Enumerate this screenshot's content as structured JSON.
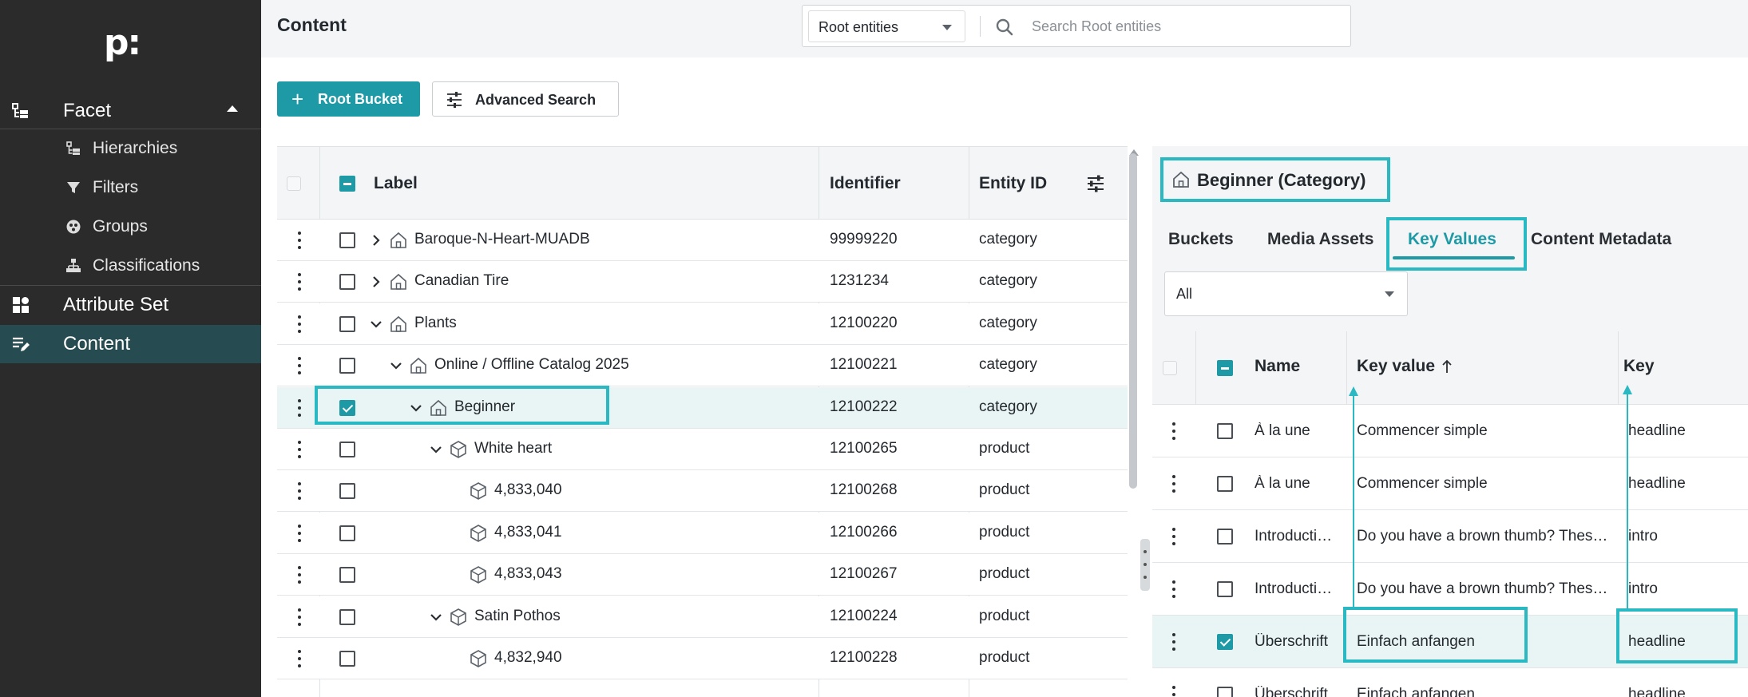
{
  "app": {
    "logo": "p:"
  },
  "sidebar": {
    "facet": {
      "label": "Facet",
      "icon": "facet-icon"
    },
    "sub_items": [
      {
        "label": "Hierarchies",
        "icon": "hierarchy-icon"
      },
      {
        "label": "Filters",
        "icon": "filter-icon"
      },
      {
        "label": "Groups",
        "icon": "groups-icon"
      },
      {
        "label": "Classifications",
        "icon": "classification-icon"
      }
    ],
    "attribute_set": {
      "label": "Attribute Set",
      "icon": "dashboard-icon"
    },
    "content": {
      "label": "Content",
      "icon": "edit-list-icon"
    }
  },
  "header": {
    "title": "Content",
    "scope_select": "Root entities",
    "search_placeholder": "Search Root entities"
  },
  "toolbar": {
    "root_bucket_label": "Root Bucket",
    "advanced_search_label": "Advanced Search"
  },
  "left_table": {
    "headers": {
      "label": "Label",
      "identifier": "Identifier",
      "entity_id": "Entity ID"
    },
    "rows": [
      {
        "label": "Baroque-N-Heart-MUADB",
        "identifier": "99999220",
        "entity_id": "category",
        "checked": false,
        "icon": "category-icon",
        "expander": "collapsed"
      },
      {
        "label": "Canadian Tire",
        "identifier": "1231234",
        "entity_id": "category",
        "checked": false,
        "icon": "category-icon",
        "expander": "collapsed"
      },
      {
        "label": "Plants",
        "identifier": "12100220",
        "entity_id": "category",
        "checked": false,
        "icon": "category-icon",
        "expander": "expanded"
      },
      {
        "label": "Online / Offline Catalog 2025",
        "identifier": "12100221",
        "entity_id": "category",
        "checked": false,
        "icon": "category-icon",
        "expander": "expanded"
      },
      {
        "label": "Beginner",
        "identifier": "12100222",
        "entity_id": "category",
        "checked": true,
        "icon": "category-icon",
        "expander": "expanded"
      },
      {
        "label": "White heart",
        "identifier": "12100265",
        "entity_id": "product",
        "checked": false,
        "icon": "product-icon",
        "expander": "expanded"
      },
      {
        "label": "4,833,040",
        "identifier": "12100268",
        "entity_id": "product",
        "checked": false,
        "icon": "product-icon",
        "expander": "none"
      },
      {
        "label": "4,833,041",
        "identifier": "12100266",
        "entity_id": "product",
        "checked": false,
        "icon": "product-icon",
        "expander": "none"
      },
      {
        "label": "4,833,043",
        "identifier": "12100267",
        "entity_id": "product",
        "checked": false,
        "icon": "product-icon",
        "expander": "none"
      },
      {
        "label": "Satin Pothos",
        "identifier": "12100224",
        "entity_id": "product",
        "checked": false,
        "icon": "product-icon",
        "expander": "expanded"
      },
      {
        "label": "4,832,940",
        "identifier": "12100228",
        "entity_id": "product",
        "checked": false,
        "icon": "product-icon",
        "expander": "none"
      }
    ]
  },
  "detail": {
    "title": "Beginner (Category)",
    "tabs": [
      "Buckets",
      "Media Assets",
      "Key Values",
      "Content Metadata"
    ],
    "active_tab": "Key Values",
    "filter_value": "All",
    "headers": {
      "name": "Name",
      "key_value": "Key value",
      "key": "Key"
    },
    "rows": [
      {
        "name": "À la une",
        "key_value": "Commencer simple",
        "key": "headline",
        "checked": false
      },
      {
        "name": "À la une",
        "key_value": "Commencer simple",
        "key": "headline",
        "checked": false
      },
      {
        "name": "Introducti…",
        "key_value": "Do you have a brown thumb? Thes…",
        "key": "intro",
        "checked": false
      },
      {
        "name": "Introducti…",
        "key_value": "Do you have a brown thumb? Thes…",
        "key": "intro",
        "checked": false
      },
      {
        "name": "Überschrift",
        "key_value": "Einfach anfangen",
        "key": "headline",
        "checked": true
      },
      {
        "name": "Überschrift",
        "key_value": "Einfach anfangen",
        "key": "headline",
        "checked": false
      }
    ]
  },
  "colors": {
    "accent": "#1e9aa7",
    "sidebar_bg": "#2b2b2b",
    "highlight": "#2ab8c2"
  }
}
